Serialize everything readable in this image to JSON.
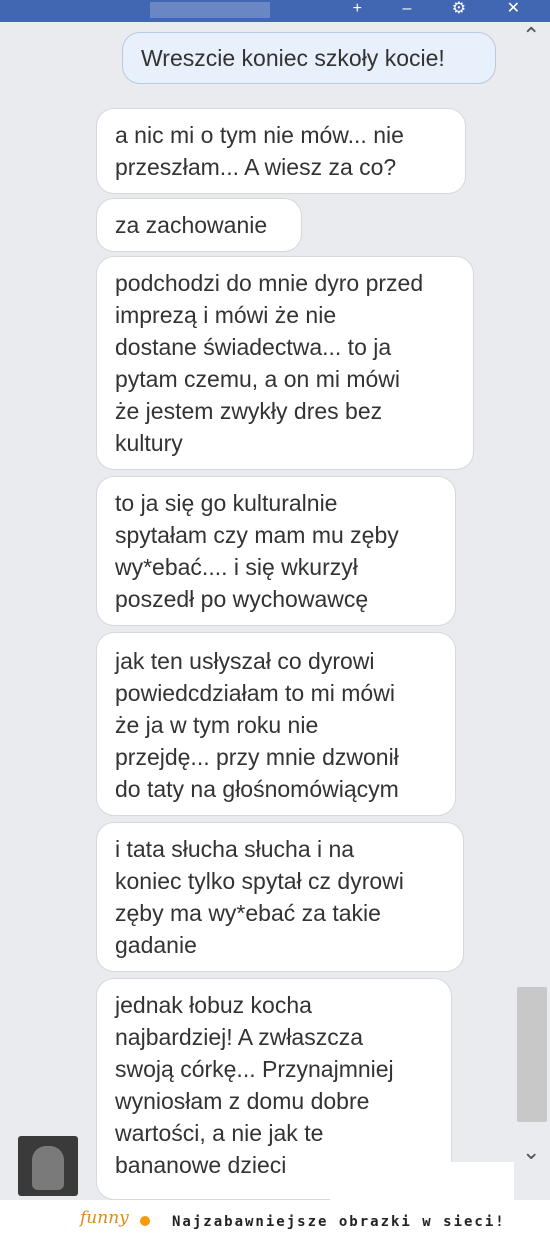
{
  "topbar": {
    "icons": "+ – ⚙ ✕"
  },
  "messages": [
    {
      "from": "me",
      "text": "Wreszcie koniec szkoły kocie!"
    },
    {
      "from": "them",
      "text": "a nic mi o tym nie mów... nie\nprzeszłam... A wiesz za co?"
    },
    {
      "from": "them",
      "text": "za zachowanie"
    },
    {
      "from": "them",
      "text": "podchodzi do mnie dyro przed\nimprezą i mówi że nie\ndostane świadectwa... to ja\npytam czemu, a on mi mówi\nże jestem zwykły dres bez\nkultury"
    },
    {
      "from": "them",
      "text": "to ja się go kulturalnie\nspytałam czy mam mu zęby\nwy*ebać.... i się wkurzył\nposzedł po wychowawcę"
    },
    {
      "from": "them",
      "text": "jak ten usłyszał co dyrowi\npowiedcdziałam to mi mówi\nże ja w tym roku nie\nprzejdę... przy mnie dzwonił\ndo taty na głośnomówiącym"
    },
    {
      "from": "them",
      "text": "i tata słucha słucha i na\nkoniec tylko spytał cz dyrowi\nzęby ma wy*ebać za takie\ngadanie"
    },
    {
      "from": "them",
      "text": "jednak łobuz kocha\nnajbardziej! A zwłaszcza\nswoją córkę... Przynajmniej\nwyniosłam z domu dobre\nwartości, a nie jak te\nbananowe dzieci"
    }
  ],
  "footer": {
    "logo": "funny",
    "slogan": "Najzabawniejsze obrazki w sieci!"
  },
  "icons": {
    "scroll_up": "chevron-up-icon",
    "scroll_down": "chevron-down-icon"
  }
}
